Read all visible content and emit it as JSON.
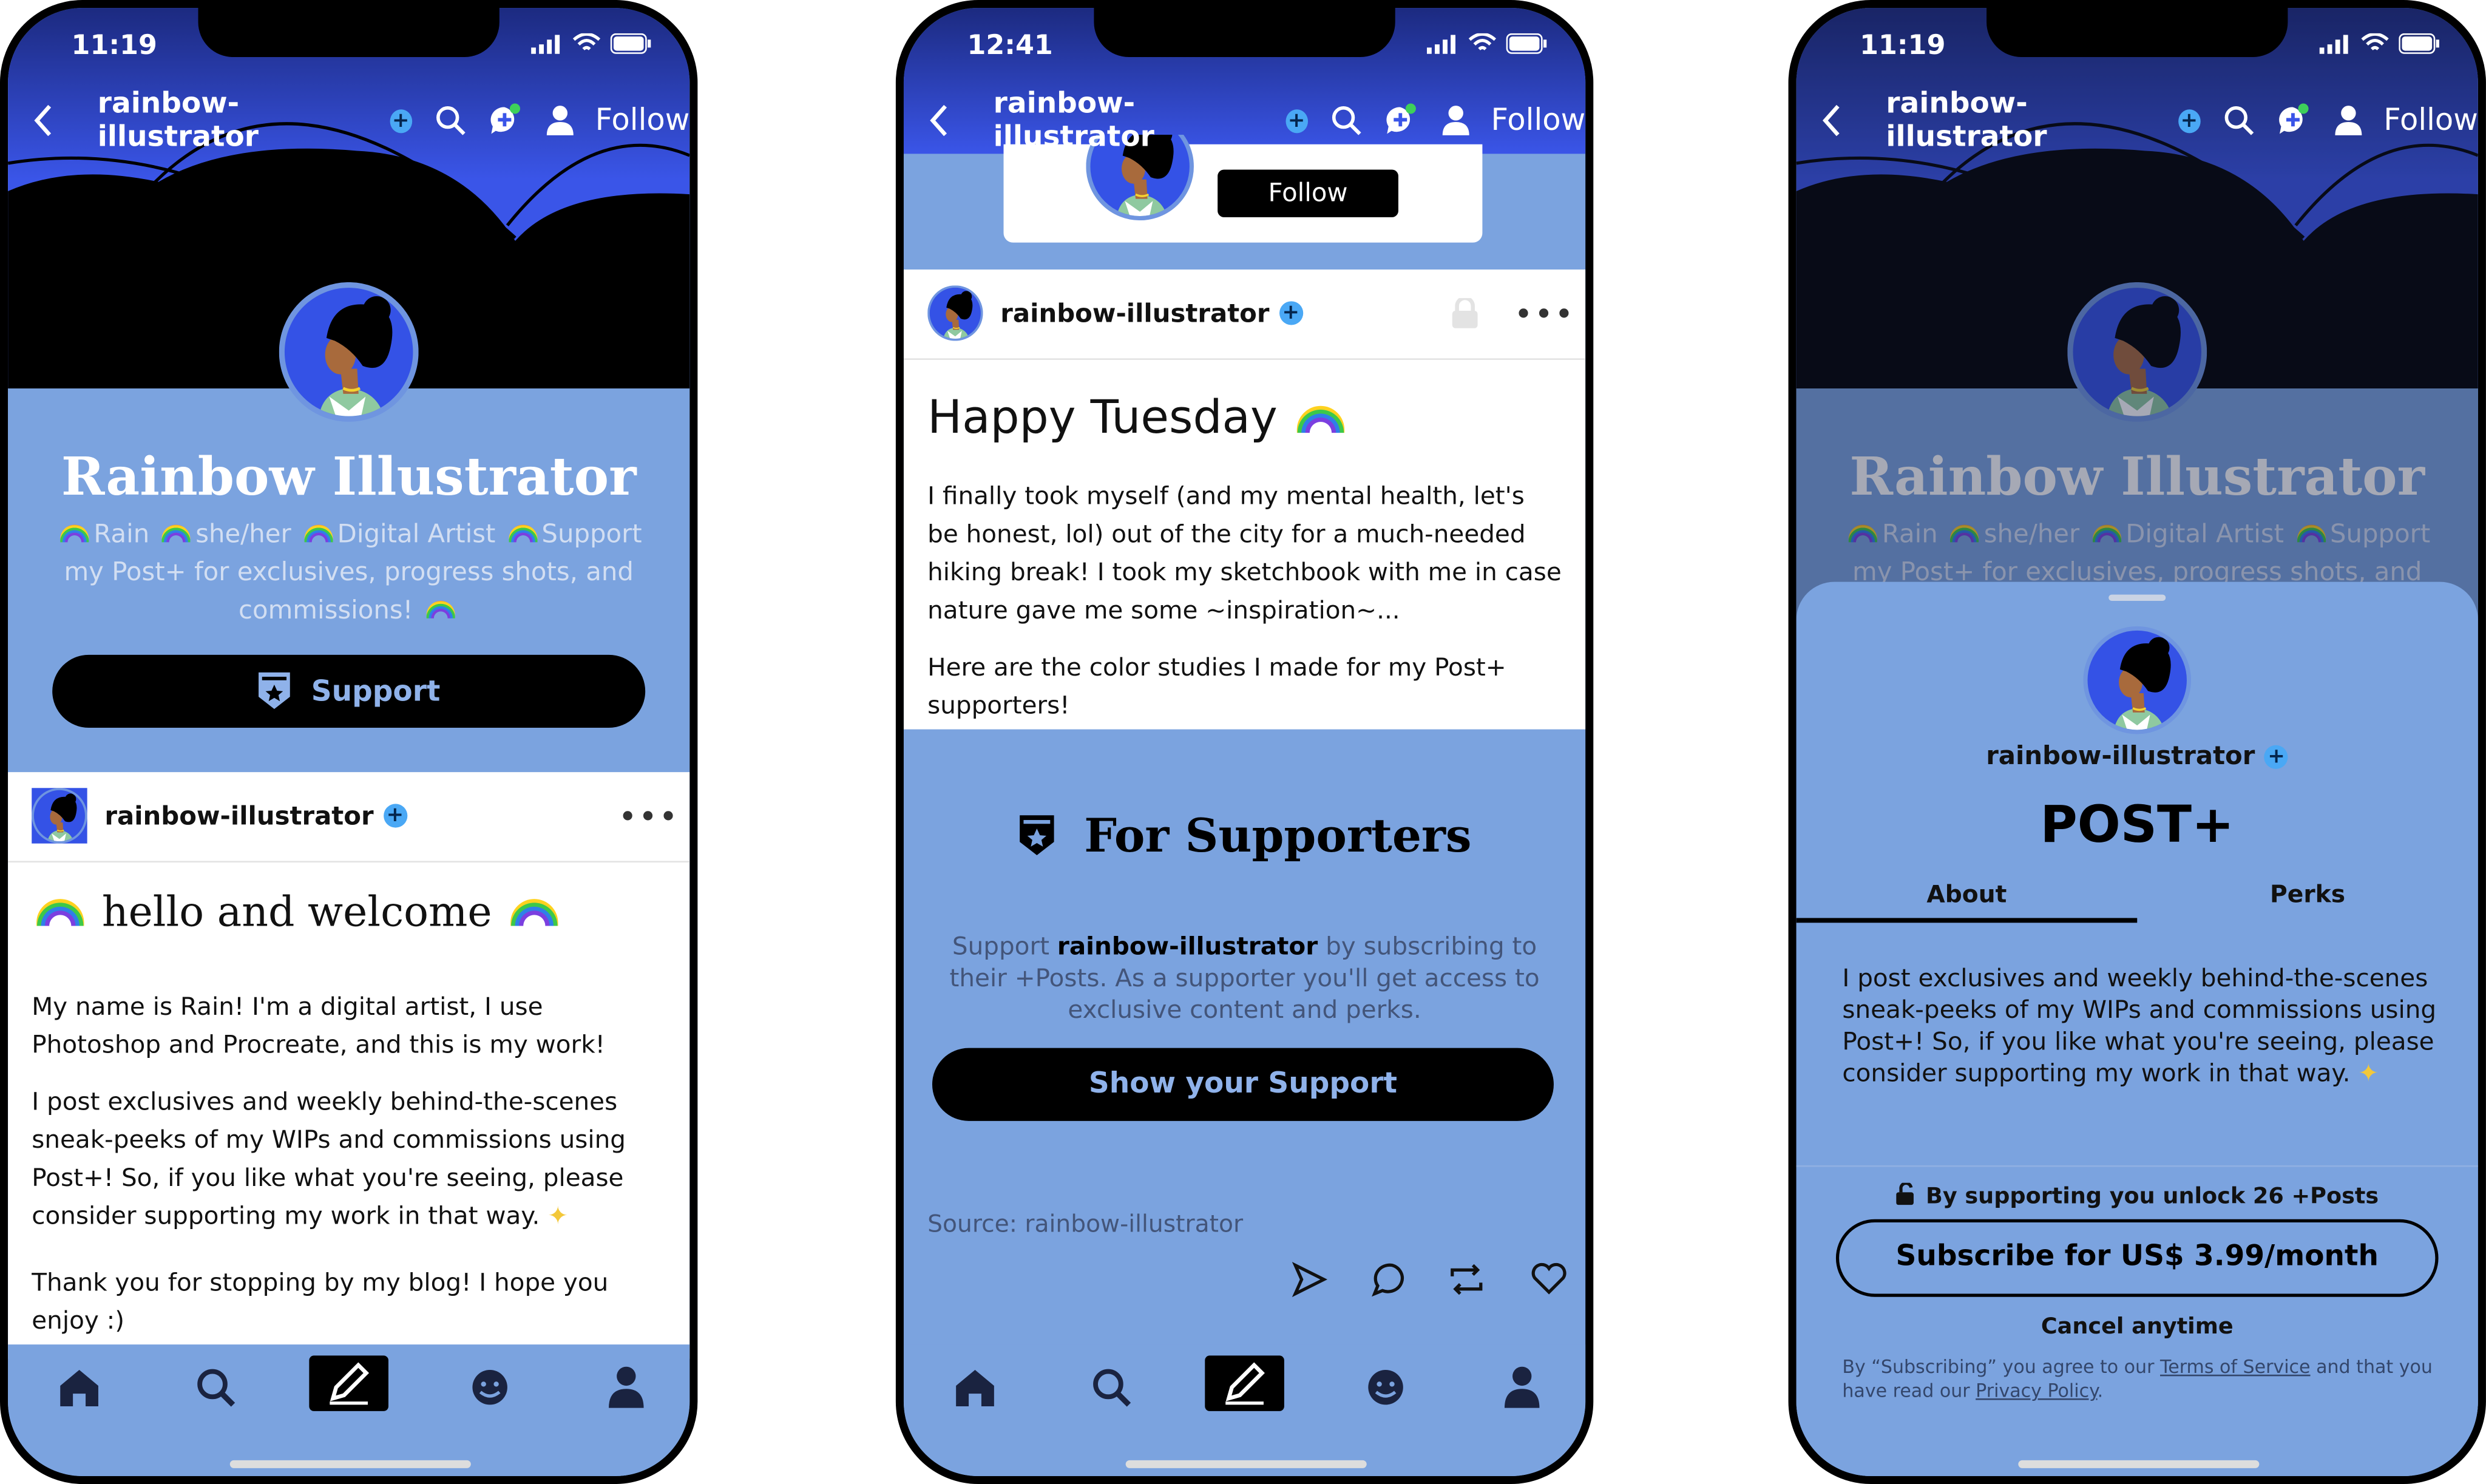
{
  "phones": [
    {
      "time": "11:19",
      "username": "rainbow-illustrator",
      "follow": "Follow",
      "title": "Rainbow Illustrator",
      "bio": [
        "Rain",
        "she/her",
        "Digital Artist",
        "Support",
        "my Post+ for exclusives, progress shots, and",
        "commissions!"
      ],
      "support_button": "Support",
      "post": {
        "author": "rainbow-illustrator",
        "title": "hello and welcome",
        "paragraphs": [
          "My name is Rain! I'm a digital artist, I use Photoshop and Procreate, and this is my work!",
          "I post exclusives and weekly behind-the-scenes sneak-peeks of my WIPs and commissions using Post+! So, if you like what you're seeing, please consider supporting my work in that way.",
          "Thank you for stopping by my blog! I hope you enjoy :)"
        ]
      }
    },
    {
      "time": "12:41",
      "username": "rainbow-illustrator",
      "follow": "Follow",
      "card_follow": "Follow",
      "post": {
        "author": "rainbow-illustrator",
        "title": "Happy Tuesday",
        "paragraphs": [
          "I finally took myself (and my mental health, let's be honest, lol) out of the city for a much-needed hiking break! I took my sketchbook with me in case nature gave me some ~inspiration~...",
          "Here are the color studies I made for my Post+ supporters!"
        ]
      },
      "supporters": {
        "title": "For Supporters",
        "text_pre": "Support ",
        "text_name": "rainbow-illustrator",
        "text_post": " by subscribing to their +Posts. As a supporter you'll get access to exclusive content and perks.",
        "button": "Show your Support"
      },
      "source": "Source: rainbow-illustrator"
    },
    {
      "time": "11:19",
      "username": "rainbow-illustrator",
      "follow": "Follow",
      "title": "Rainbow Illustrator",
      "bio": [
        "Rain",
        "she/her",
        "Digital Artist",
        "Support",
        "my Post+ for exclusives, progress shots, and"
      ],
      "sheet": {
        "username": "rainbow-illustrator",
        "heading": "POST+",
        "tabs": [
          "About",
          "Perks"
        ],
        "active_tab": "About",
        "about": "I post exclusives and weekly behind-the-scenes sneak-peeks of my WIPs and commissions using Post+! So, if you like what you're seeing, please consider supporting my work in that way.",
        "unlock": "By supporting you unlock 26 +Posts",
        "subscribe": "Subscribe for US$ 3.99/month",
        "cancel": "Cancel anytime",
        "legal_pre": "By “Subscribing” you agree to our ",
        "tos": "Terms of Service",
        "legal_mid": " and that you have read our ",
        "privacy": "Privacy Policy",
        "legal_end": "."
      }
    }
  ],
  "bottom_nav": [
    "home-icon",
    "search-icon",
    "compose-icon",
    "activity-icon",
    "account-icon"
  ],
  "colors": {
    "accent_blue": "#7ba3df",
    "header_blue": "#3a55e8",
    "verified": "#4aa8f5",
    "dark": "#000000"
  }
}
